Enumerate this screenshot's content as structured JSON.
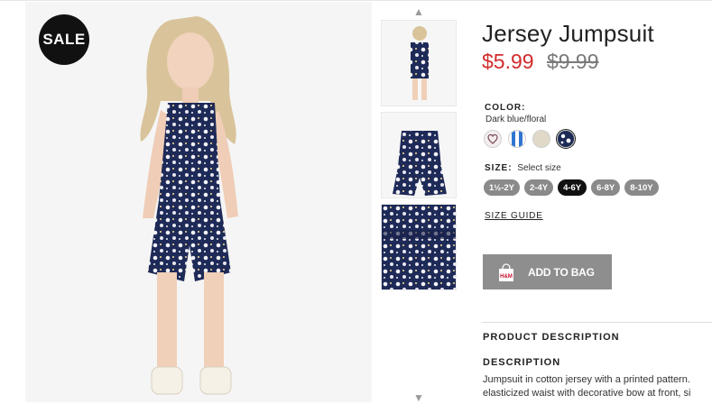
{
  "badge": {
    "text": "SALE"
  },
  "product": {
    "title": "Jersey Jumpsuit",
    "price_sale": "$5.99",
    "price_original": "$9.99"
  },
  "color": {
    "label": "COLOR:",
    "selected": "Dark blue/floral",
    "swatches": [
      {
        "name": "heart print",
        "bg": "#f4eeee",
        "fg": "#7a4a5a"
      },
      {
        "name": "blue striped",
        "bg": "#ffffff",
        "fg": "#2f76d0"
      },
      {
        "name": "beige",
        "bg": "#e0d9c8",
        "fg": "#e0d9c8"
      },
      {
        "name": "dark blue floral",
        "bg": "#1c2b55",
        "fg": "#ffffff"
      }
    ]
  },
  "size": {
    "label": "SIZE:",
    "hint": "Select size",
    "options": [
      "1½-2Y",
      "2-4Y",
      "4-6Y",
      "6-8Y",
      "8-10Y"
    ],
    "active_index": 2
  },
  "size_guide": {
    "label": "SIZE GUIDE"
  },
  "cart": {
    "button_label": "ADD TO BAG",
    "icon_text": "H&M"
  },
  "sections": {
    "product_description": "PRODUCT DESCRIPTION",
    "description_heading": "DESCRIPTION",
    "description_line1": "Jumpsuit in cotton jersey with a printed pattern.",
    "description_line2": "elasticized waist with decorative bow at front, si"
  },
  "thumbnails": {
    "up_arrow": "▲",
    "down_arrow": "▼"
  },
  "colors": {
    "sale_price": "#d12b2b",
    "button": "#8e8e8e",
    "active_size": "#111111",
    "size": "#8a8a8a"
  }
}
